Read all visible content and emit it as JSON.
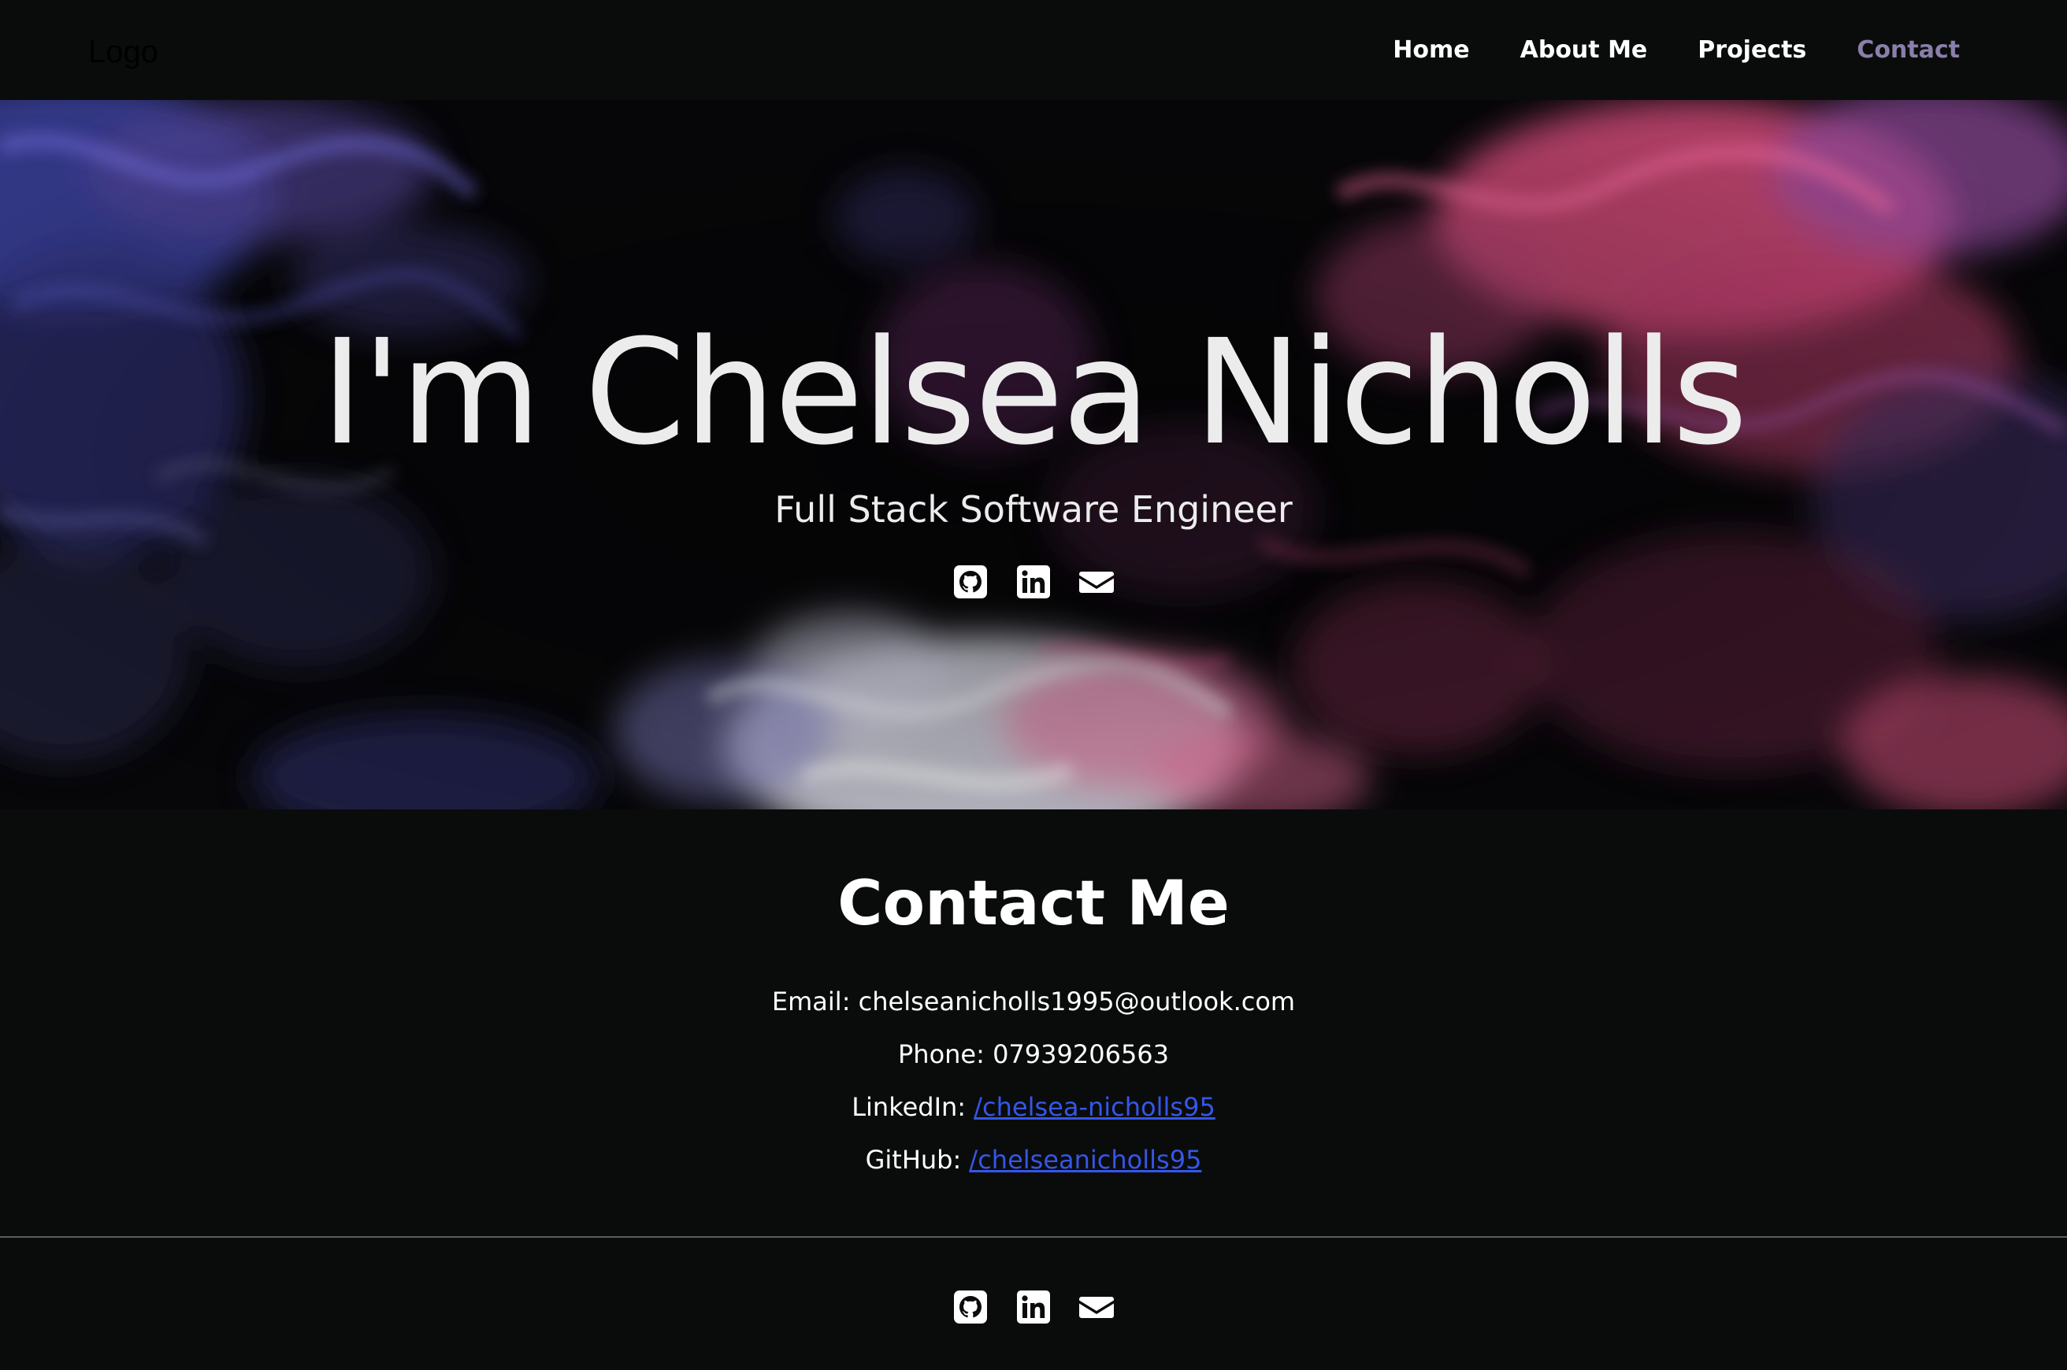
{
  "navbar": {
    "logo": "Logo",
    "links": [
      {
        "label": "Home"
      },
      {
        "label": "About Me"
      },
      {
        "label": "Projects"
      },
      {
        "label": "Contact",
        "active": true
      }
    ],
    "active_color": "#8a7fa8"
  },
  "hero": {
    "title": "I'm Chelsea Nicholls",
    "subtitle": "Full Stack Software Engineer",
    "social_icons": [
      "github-icon",
      "linkedin-icon",
      "envelope-icon"
    ],
    "background": "abstract dark paint swirl (blue, pink, white)"
  },
  "contact": {
    "heading": "Contact Me",
    "email_label": "Email:",
    "email_value": "chelseanicholls1995@outlook.com",
    "phone_label": "Phone:",
    "phone_value": "07939206563",
    "linkedin_label": "LinkedIn:",
    "linkedin_link": "/chelsea-nicholls95",
    "github_label": "GitHub:",
    "github_link": "/chelseanicholls95",
    "link_color": "#3556e8"
  },
  "footer": {
    "social_icons": [
      "github-icon",
      "linkedin-icon",
      "envelope-icon"
    ]
  },
  "colors": {
    "background": "#0a0c0c",
    "text": "#ffffff",
    "divider": "#5a5c5e"
  }
}
